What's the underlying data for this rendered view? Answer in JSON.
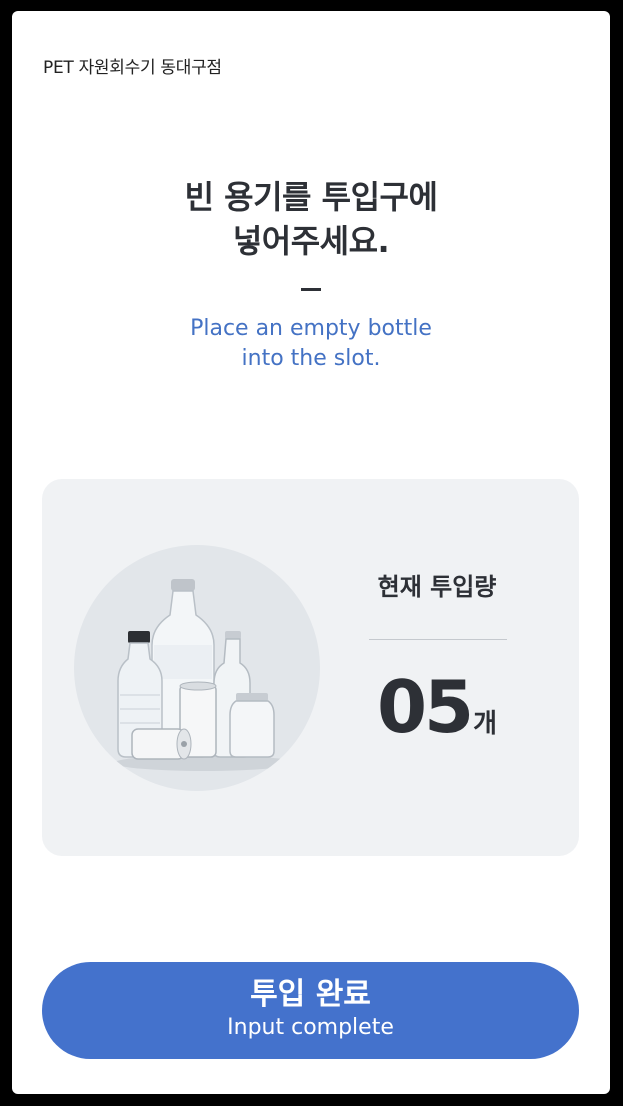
{
  "header": {
    "location": "PET 자원회수기 동대구점"
  },
  "instruction": {
    "title_line1": "빈 용기를 투입구에",
    "title_line2": "넣어주세요.",
    "subtitle_line1": "Place an empty bottle",
    "subtitle_line2": "into the slot."
  },
  "status_card": {
    "image_icon": "bottles-image",
    "label": "현재 투입량",
    "count": "05",
    "unit": "개"
  },
  "action": {
    "complete_label": "투입 완료",
    "complete_sublabel": "Input complete"
  },
  "colors": {
    "accent": "#4472cc",
    "subtitle": "#4472c4",
    "card_bg": "#f0f2f4",
    "text_dark": "#2d3036"
  }
}
